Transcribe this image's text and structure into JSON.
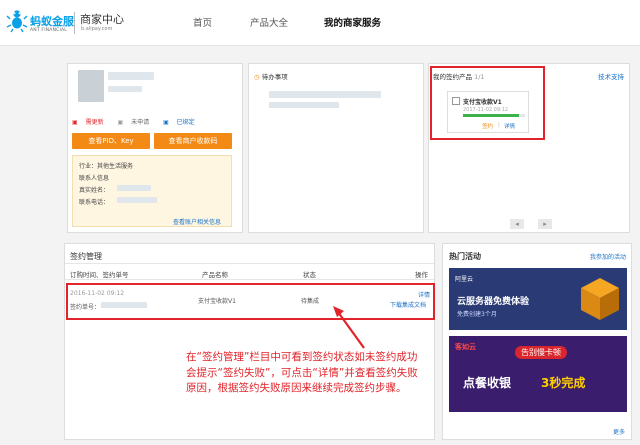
{
  "brand": {
    "logo_cn": "蚂蚁金服",
    "logo_en": "ANT FINANCIAL",
    "title": "商家中心",
    "url": "b.alipay.com"
  },
  "nav": [
    "首页",
    "产品大全",
    "我的商家服务"
  ],
  "account": {
    "links": [
      "需更新",
      "未申请",
      "已绑定"
    ],
    "btn_pid": "查看PID、Key",
    "btn_qr": "查看商户收款码",
    "info": [
      "行业：其他生活服务",
      "联系人信息",
      "真实姓名：",
      "联系电话："
    ],
    "more_link": "查看账户相关信息"
  },
  "todo": {
    "title": "待办事项"
  },
  "products": {
    "title": "我的签约产品",
    "count": "1/1",
    "support": "技术支持",
    "item_name": "支付宝收款V1",
    "item_date": "2017-11-02 09:12",
    "progress": 0.9,
    "action_sign": "签约",
    "action_detail": "详情"
  },
  "contracts": {
    "title": "签约管理",
    "columns": [
      "订购时间、签约单号",
      "产品名称",
      "状态",
      "操作"
    ],
    "row": {
      "time": "2016-11-02 09:12",
      "order_label": "签约单号：",
      "product": "支付宝收款V1",
      "status": "待集成",
      "action_detail": "详情",
      "action_download": "下载集成文档"
    }
  },
  "annotation": "在“签约管理”栏目中可看到签约状态如未签约成功会提示“签约失败”，可点击“详情”并查看签约失败原因，根据签约失败原因来继续完成签约步骤。",
  "hot": {
    "title": "热门活动",
    "more_link": "我参加的活动",
    "ad1_logo": "阿里云",
    "ad1_title": "云服务器免费体验",
    "ad1_sub": "免费创建3个月",
    "ad2_brand": "客如云",
    "ad2_top": "告别慢卡顿",
    "ad2_main": "点餐收银",
    "ad2_speed": "3秒完成",
    "more": "更多"
  },
  "colors": {
    "accent_blue": "#0aa0e8",
    "orange": "#f28a15",
    "annotation_red": "#e0242a",
    "link_blue": "#1a73c9",
    "progress_green": "#3cb34a"
  }
}
